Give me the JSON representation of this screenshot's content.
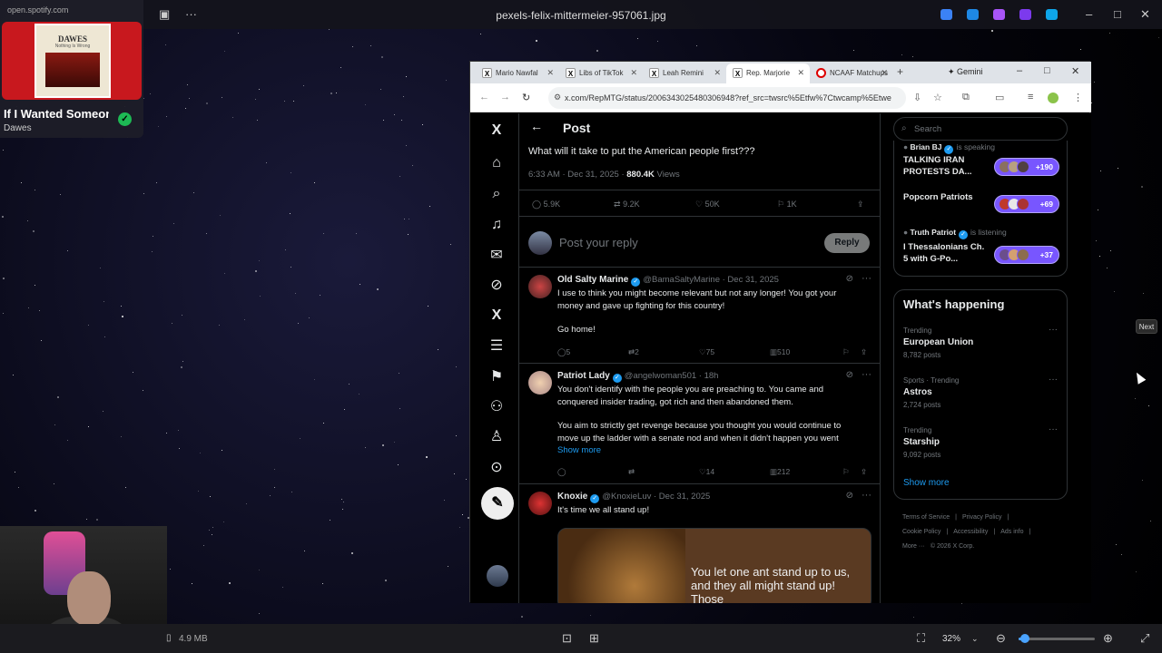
{
  "viewer": {
    "title": "pexels-felix-mittermeier-957061.jpg",
    "file_size": "4.9 MB",
    "zoom": "32%",
    "zoom_fraction": 0.08,
    "next_label": "Next"
  },
  "spotify": {
    "source": "open.spotify.com",
    "album_title": "DAWES",
    "album_subtitle": "Nothing Is Wrong",
    "track": "If I Wanted Someone",
    "artist": "Dawes"
  },
  "browser": {
    "tabs": [
      {
        "label": "Mario Nawfal",
        "icon": "x-logo-icon"
      },
      {
        "label": "Libs of TikTok",
        "icon": "x-logo-icon"
      },
      {
        "label": "Leah Remini",
        "icon": "x-logo-icon"
      },
      {
        "label": "Rep. Marjorie",
        "icon": "x-logo-icon",
        "active": true
      },
      {
        "label": "NCAAF Matchups",
        "icon": "ncaaf-icon"
      }
    ],
    "gemini_label": "Gemini",
    "url": "x.com/RepMTG/status/2006343025480306948?ref_src=twsrc%5Etfw%7Ctwcamp%5Etweetembed"
  },
  "post": {
    "header_title": "Post",
    "text": "What will it take to put the American people first???",
    "time": "6:33 AM · Dec 31, 2025 ·",
    "views": "880.4K",
    "views_label": "Views",
    "replies": "5.9K",
    "reposts": "9.2K",
    "likes": "50K",
    "bookmarks": "1K",
    "reply_placeholder": "Post your reply",
    "reply_button": "Reply"
  },
  "replies": [
    {
      "name": "Old Salty Marine",
      "handle": "@BamaSaltyMarine · Dec 31, 2025",
      "line1": "I use to think you might become relevant but not any longer! You got your",
      "line2": "money and gave up fighting for this country!",
      "line3": "Go home!",
      "replies": "5",
      "reposts": "2",
      "likes": "75",
      "views": "510"
    },
    {
      "name": "Patriot Lady",
      "handle": "@angelwoman501 · 18h",
      "line1": "You don't identify with the people you are preaching to. You came and",
      "line2": "conquered insider trading, got rich and then abandoned them.",
      "line3": "You aim to strictly get revenge because you thought you would continue to",
      "line4": "move up the ladder with a senate nod and when it didn't happen you went",
      "show_more": "Show more",
      "replies": "",
      "reposts": "",
      "likes": "14",
      "views": "212"
    },
    {
      "name": "Knoxie",
      "handle": "@KnoxieLuv · Dec 31, 2025",
      "line1": "It's time we all stand up!",
      "image_text": "You let one ant stand up to us, and they all might stand up! Those"
    }
  ],
  "right": {
    "search_placeholder": "Search",
    "spaces": [
      {
        "host": "Brian BJ",
        "status": "is speaking",
        "title": "TALKING IRAN PROTESTS DA...",
        "count": "+190"
      },
      {
        "host": "",
        "status": "",
        "title": "Popcorn Patriots",
        "count": "+69"
      },
      {
        "host": "Truth Patriot",
        "status": "is listening",
        "title": "I Thessalonians Ch. 5 with G-Po...",
        "count": "+37"
      }
    ],
    "happening_title": "What's happening",
    "trends": [
      {
        "meta": "Trending",
        "name": "European Union",
        "posts": "8,782 posts"
      },
      {
        "meta": "Sports · Trending",
        "name": "Astros",
        "posts": "2,724 posts"
      },
      {
        "meta": "Trending",
        "name": "Starship",
        "posts": "9,092 posts"
      }
    ],
    "show_more": "Show more",
    "footer": [
      "Terms of Service",
      "|",
      "Privacy Policy",
      "|",
      "Cookie Policy",
      "|",
      "Accessibility",
      "|",
      "Ads info",
      "|",
      "More ···",
      "© 2026 X Corp."
    ]
  }
}
